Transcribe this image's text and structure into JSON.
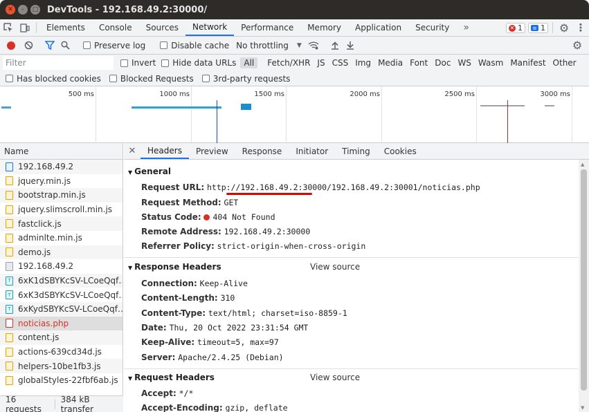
{
  "window": {
    "title": "DevTools - 192.168.49.2:30000/"
  },
  "tabs": [
    "Elements",
    "Console",
    "Sources",
    "Network",
    "Performance",
    "Memory",
    "Application",
    "Security"
  ],
  "active_tab": "Network",
  "badges": {
    "errors": "1",
    "messages": "1"
  },
  "toolbar": {
    "preserve_log": "Preserve log",
    "disable_cache": "Disable cache",
    "throttling": "No throttling"
  },
  "filter": {
    "placeholder": "Filter",
    "invert": "Invert",
    "hide_data_urls": "Hide data URLs",
    "types": [
      "All",
      "Fetch/XHR",
      "JS",
      "CSS",
      "Img",
      "Media",
      "Font",
      "Doc",
      "WS",
      "Wasm",
      "Manifest",
      "Other"
    ],
    "active_type": "All",
    "has_blocked_cookies": "Has blocked cookies",
    "blocked_requests": "Blocked Requests",
    "third_party": "3rd-party requests"
  },
  "timeline": {
    "ticks": [
      "500 ms",
      "1000 ms",
      "1500 ms",
      "2000 ms",
      "2500 ms",
      "3000 ms"
    ]
  },
  "requests": {
    "header": "Name",
    "items": [
      {
        "name": "192.168.49.2",
        "type": "doc"
      },
      {
        "name": "jquery.min.js",
        "type": "js"
      },
      {
        "name": "bootstrap.min.js",
        "type": "js"
      },
      {
        "name": "jquery.slimscroll.min.js",
        "type": "js"
      },
      {
        "name": "fastclick.js",
        "type": "js"
      },
      {
        "name": "adminlte.min.js",
        "type": "js"
      },
      {
        "name": "demo.js",
        "type": "js"
      },
      {
        "name": "192.168.49.2",
        "type": "other"
      },
      {
        "name": "6xK1dSBYKcSV-LCoeQqf…",
        "type": "font"
      },
      {
        "name": "6xK3dSBYKcSV-LCoeQqf…",
        "type": "font"
      },
      {
        "name": "6xKydSBYKcSV-LCoeQqf…",
        "type": "font"
      },
      {
        "name": "noticias.php",
        "type": "err"
      },
      {
        "name": "content.js",
        "type": "js"
      },
      {
        "name": "actions-639cd34d.js",
        "type": "js"
      },
      {
        "name": "helpers-10be1fb3.js",
        "type": "js"
      },
      {
        "name": "globalStyles-22fbf6ab.js",
        "type": "js"
      }
    ],
    "summary_requests": "16 requests",
    "summary_transfer": "384 kB transfer"
  },
  "details": {
    "tabs": [
      "Headers",
      "Preview",
      "Response",
      "Initiator",
      "Timing",
      "Cookies"
    ],
    "active_tab": "Headers",
    "general": {
      "title": "General",
      "request_url_label": "Request URL:",
      "request_url": "http://192.168.49.2:30000/192.168.49.2:30001/noticias.php",
      "request_method_label": "Request Method:",
      "request_method": "GET",
      "status_code_label": "Status Code:",
      "status_code": "404 Not Found",
      "remote_address_label": "Remote Address:",
      "remote_address": "192.168.49.2:30000",
      "referrer_policy_label": "Referrer Policy:",
      "referrer_policy": "strict-origin-when-cross-origin"
    },
    "response_headers": {
      "title": "Response Headers",
      "view_source": "View source",
      "rows": [
        {
          "k": "Connection:",
          "v": "Keep-Alive"
        },
        {
          "k": "Content-Length:",
          "v": "310"
        },
        {
          "k": "Content-Type:",
          "v": "text/html; charset=iso-8859-1"
        },
        {
          "k": "Date:",
          "v": "Thu, 20 Oct 2022 23:31:54 GMT"
        },
        {
          "k": "Keep-Alive:",
          "v": "timeout=5, max=97"
        },
        {
          "k": "Server:",
          "v": "Apache/2.4.25 (Debian)"
        }
      ]
    },
    "request_headers": {
      "title": "Request Headers",
      "view_source": "View source",
      "rows": [
        {
          "k": "Accept:",
          "v": "*/*"
        },
        {
          "k": "Accept-Encoding:",
          "v": "gzip, deflate"
        }
      ]
    }
  }
}
